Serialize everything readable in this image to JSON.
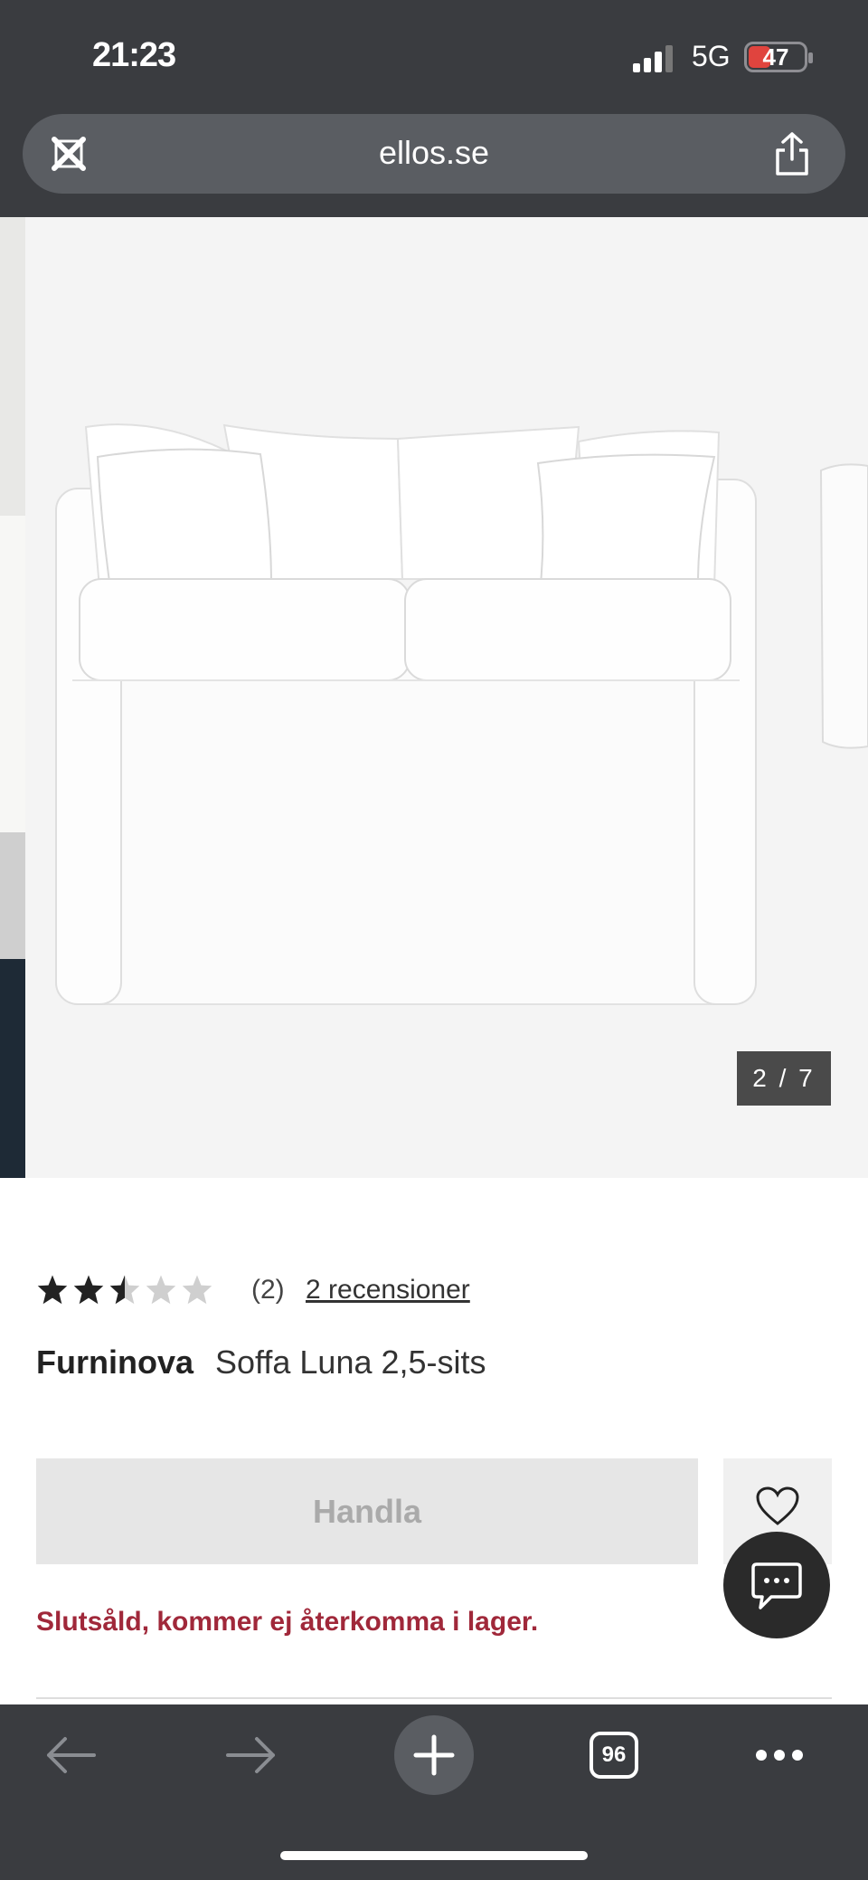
{
  "status_bar": {
    "time": "21:23",
    "network": "5G",
    "battery": "47"
  },
  "browser": {
    "url": "ellos.se"
  },
  "gallery": {
    "counter": "2 / 7"
  },
  "product": {
    "rating": 2.5,
    "rating_max": 5,
    "rating_count": "(2)",
    "reviews_link": "2 recensioner",
    "brand": "Furninova",
    "name": "Soffa Luna 2,5-sits",
    "buy_label": "Handla",
    "stock_status": "Slutsåld, kommer ej återkomma i lager."
  },
  "toolbar": {
    "tab_count": "96"
  },
  "colors": {
    "chrome": "#3a3c40",
    "soldout": "#a0283a",
    "star": "#222222"
  }
}
